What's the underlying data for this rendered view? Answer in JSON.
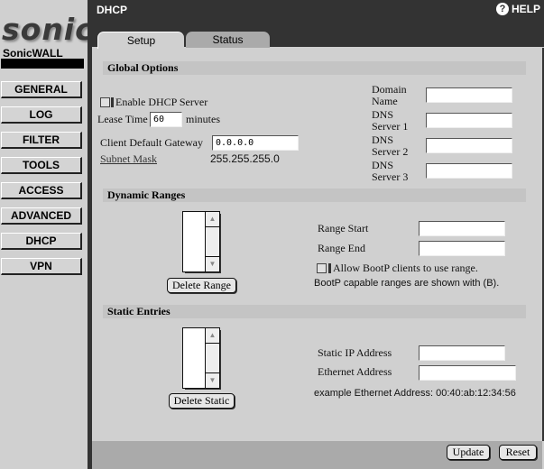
{
  "brand": {
    "logo_text": "sonic",
    "name": "SonicWALL"
  },
  "sidebar": {
    "items": [
      {
        "label": "GENERAL"
      },
      {
        "label": "LOG"
      },
      {
        "label": "FILTER"
      },
      {
        "label": "TOOLS"
      },
      {
        "label": "ACCESS"
      },
      {
        "label": "ADVANCED"
      },
      {
        "label": "DHCP"
      },
      {
        "label": "VPN"
      }
    ]
  },
  "header": {
    "title": "DHCP",
    "help_label": "HELP",
    "help_icon": "?"
  },
  "tabs": [
    {
      "label": "Setup",
      "active": true
    },
    {
      "label": "Status",
      "active": false
    }
  ],
  "global_options": {
    "title": "Global Options",
    "enable_dhcp_label": "Enable DHCP Server",
    "enable_dhcp_checked": false,
    "lease_time_label": "Lease Time",
    "lease_time_value": "60",
    "lease_time_unit": "minutes",
    "gateway_label": "Client Default Gateway",
    "gateway_value": "0.0.0.0",
    "subnet_mask_label": "Subnet Mask",
    "subnet_mask_value": "255.255.255.0",
    "domain_name_label_1": "Domain",
    "domain_name_label_2": "Name",
    "domain_name_value": "",
    "dns1_label_1": "DNS",
    "dns1_label_2": "Server 1",
    "dns1_value": "",
    "dns2_label_1": "DNS",
    "dns2_label_2": "Server 2",
    "dns2_value": "",
    "dns3_label_1": "DNS",
    "dns3_label_2": "Server 3",
    "dns3_value": ""
  },
  "dynamic_ranges": {
    "title": "Dynamic Ranges",
    "delete_label": "Delete Range",
    "range_start_label": "Range Start",
    "range_start_value": "",
    "range_end_label": "Range End",
    "range_end_value": "",
    "bootp_label": "Allow BootP clients to use range.",
    "bootp_checked": false,
    "bootp_note": "BootP capable ranges are shown with (B).",
    "scroll_up": "▲",
    "scroll_down": "▼"
  },
  "static_entries": {
    "title": "Static Entries",
    "delete_label": "Delete Static",
    "static_ip_label": "Static IP Address",
    "static_ip_value": "",
    "ethernet_label": "Ethernet Address",
    "ethernet_value": "",
    "example_note": "example Ethernet Address: 00:40:ab:12:34:56",
    "scroll_up": "▲",
    "scroll_down": "▼"
  },
  "footer": {
    "update_label": "Update",
    "reset_label": "Reset"
  }
}
